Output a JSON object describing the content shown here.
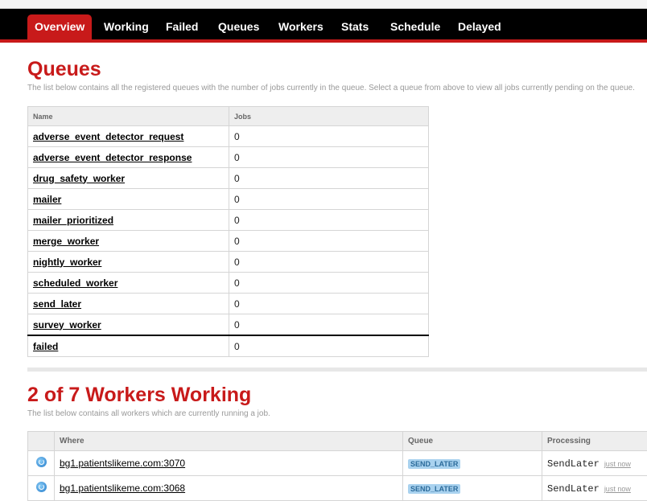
{
  "nav": {
    "tabs": [
      {
        "label": "Overview",
        "active": true
      },
      {
        "label": "Working"
      },
      {
        "label": "Failed"
      },
      {
        "label": "Queues"
      },
      {
        "label": "Workers"
      },
      {
        "label": "Stats"
      },
      {
        "label": "Schedule"
      },
      {
        "label": "Delayed"
      }
    ]
  },
  "queues_section": {
    "title": "Queues",
    "description": "The list below contains all the registered queues with the number of jobs currently in the queue. Select a queue from above to view all jobs currently pending on the queue.",
    "columns": [
      "Name",
      "Jobs"
    ],
    "rows": [
      {
        "name": "adverse_event_detector_request",
        "jobs": "0"
      },
      {
        "name": "adverse_event_detector_response",
        "jobs": "0"
      },
      {
        "name": "drug_safety_worker",
        "jobs": "0"
      },
      {
        "name": "mailer",
        "jobs": "0"
      },
      {
        "name": "mailer_prioritized",
        "jobs": "0"
      },
      {
        "name": "merge_worker",
        "jobs": "0"
      },
      {
        "name": "nightly_worker",
        "jobs": "0"
      },
      {
        "name": "scheduled_worker",
        "jobs": "0"
      },
      {
        "name": "send_later",
        "jobs": "0"
      },
      {
        "name": "survey_worker",
        "jobs": "0"
      }
    ],
    "failed_row": {
      "name": "failed",
      "jobs": "0"
    }
  },
  "workers_section": {
    "title": "2 of 7 Workers Working",
    "description": "The list below contains all workers which are currently running a job.",
    "columns": [
      "",
      "Where",
      "Queue",
      "Processing"
    ],
    "rows": [
      {
        "icon": "refresh-icon",
        "where": "bg1.patientslikeme.com:3070",
        "queue": "SEND_LATER",
        "processing": "SendLater",
        "time": "just now"
      },
      {
        "icon": "refresh-icon",
        "where": "bg1.patientslikeme.com:3068",
        "queue": "SEND_LATER",
        "processing": "SendLater",
        "time": "just now"
      }
    ]
  },
  "colors": {
    "accent": "#c81a1a",
    "nav_bg": "#000000",
    "badge_bg": "#a9d2ef"
  }
}
